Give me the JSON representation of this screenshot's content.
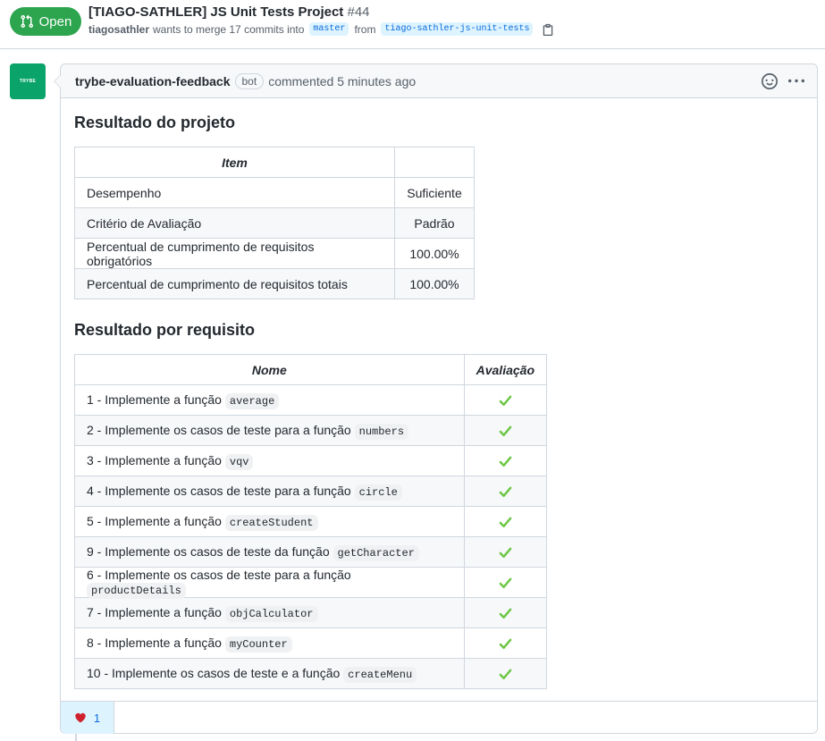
{
  "pr": {
    "state": "Open",
    "title": "[TIAGO-SATHLER] JS Unit Tests Project",
    "number": "#44",
    "author": "tiagosathler",
    "merge_text": "wants to merge 17 commits into",
    "base_branch": "master",
    "from_text": "from",
    "head_branch": "tiago-sathler-js-unit-tests"
  },
  "comment": {
    "avatar_text": "TRYBE",
    "author": "trybe-evaluation-feedback",
    "badge": "bot",
    "time": "commented 5 minutes ago",
    "section1_title": "Resultado do projeto",
    "table1": {
      "header": "Item",
      "rows": [
        {
          "label": "Desempenho",
          "value": "Suficiente"
        },
        {
          "label": "Critério de Avaliação",
          "value": "Padrão"
        },
        {
          "label": "Percentual de cumprimento de requisitos obrigatórios",
          "value": "100.00%"
        },
        {
          "label": "Percentual de cumprimento de requisitos totais",
          "value": "100.00%"
        }
      ]
    },
    "section2_title": "Resultado por requisito",
    "table2": {
      "header_name": "Nome",
      "header_eval": "Avaliação",
      "rows": [
        {
          "text": "1 - Implemente a função",
          "code": "average"
        },
        {
          "text": "2 - Implemente os casos de teste para a função",
          "code": "numbers"
        },
        {
          "text": "3 - Implemente a função",
          "code": "vqv"
        },
        {
          "text": "4 - Implemente os casos de teste para a função",
          "code": "circle"
        },
        {
          "text": "5 - Implemente a função",
          "code": "createStudent"
        },
        {
          "text": "9 - Implemente os casos de teste da função",
          "code": "getCharacter"
        },
        {
          "text": "6 - Implemente os casos de teste para a função",
          "code": "productDetails"
        },
        {
          "text": "7 - Implemente a função",
          "code": "objCalculator"
        },
        {
          "text": "8 - Implemente a função",
          "code": "myCounter"
        },
        {
          "text": "10 - Implemente os casos de teste e a função",
          "code": "createMenu"
        }
      ]
    },
    "reaction": {
      "icon": "heart-icon",
      "count": "1"
    }
  },
  "colors": {
    "open_green": "#2da44e",
    "check_green": "#6cc644",
    "link_blue": "#0969da",
    "heart_red": "#cf222e"
  }
}
